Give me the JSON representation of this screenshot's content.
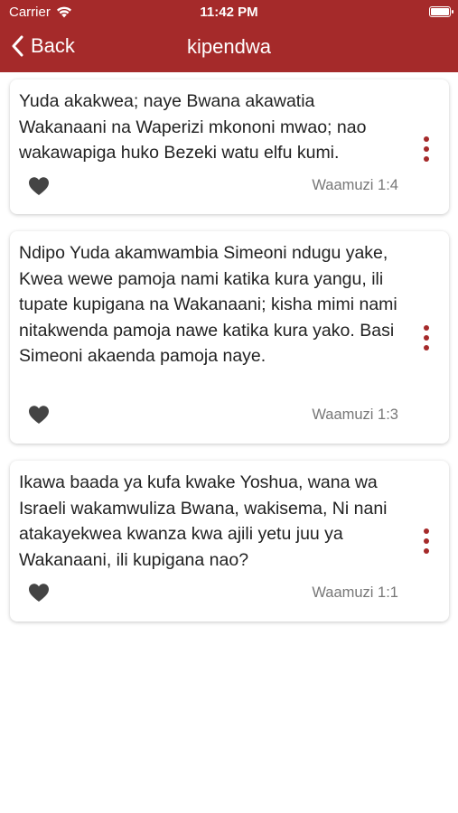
{
  "status_bar": {
    "carrier": "Carrier",
    "time": "11:42 PM"
  },
  "nav": {
    "back_label": "Back",
    "title": "kipendwa"
  },
  "colors": {
    "accent": "#a52a2a",
    "card_bg": "#ffffff",
    "reference": "#777777",
    "heart": "#444444"
  },
  "verses": [
    {
      "text": "Yuda akakwea; naye Bwana akawatia Wakanaani na Waperizi mkononi mwao; nao wakawapiga huko Bezeki watu elfu kumi.",
      "reference": "Waamuzi 1:4"
    },
    {
      "text": "Ndipo Yuda akamwambia Simeoni ndugu yake, Kwea wewe pamoja nami katika kura yangu, ili tupate kupigana na Wakanaani; kisha mimi nami nitakwenda pamoja nawe katika kura yako. Basi Simeoni akaenda pamoja naye.",
      "reference": "Waamuzi 1:3"
    },
    {
      "text": "Ikawa baada ya kufa kwake Yoshua, wana wa Israeli wakamwuliza Bwana, wakisema, Ni nani atakayekwea kwanza kwa ajili yetu juu ya Wakanaani, ili kupigana nao?",
      "reference": "Waamuzi 1:1"
    }
  ]
}
